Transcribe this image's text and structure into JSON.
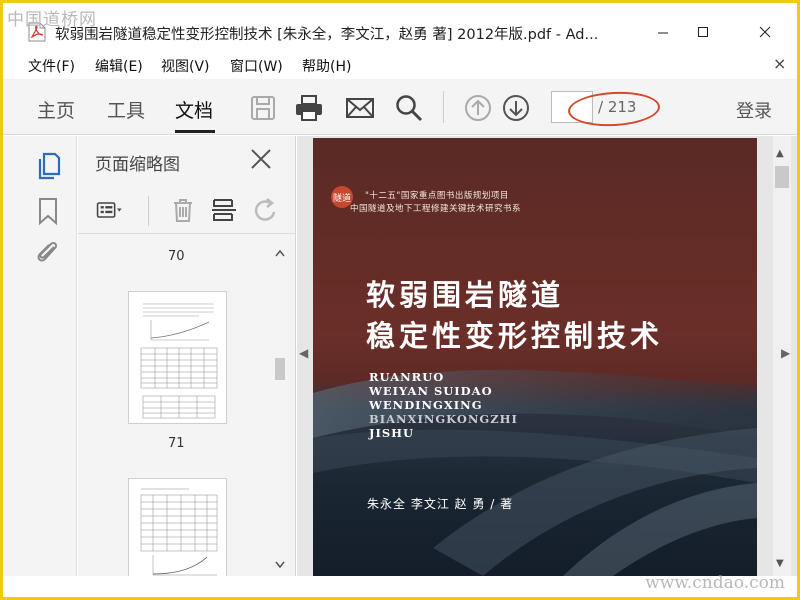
{
  "watermarks": {
    "top": "中国道桥网",
    "bottom": "www.cndao.com"
  },
  "window": {
    "title": "软弱围岩隧道稳定性变形控制技术 [朱永全，李文江，赵勇 著] 2012年版.pdf - Ad..."
  },
  "menu": {
    "items": [
      "文件(F)",
      "编辑(E)",
      "视图(V)",
      "窗口(W)",
      "帮助(H)"
    ],
    "close": "×"
  },
  "toolbar": {
    "tabs": [
      "主页",
      "工具",
      "文档"
    ],
    "active_tab": "文档",
    "page_total": "/ 213",
    "login": "登录",
    "icons": [
      "save-icon",
      "print-icon",
      "email-icon",
      "search-icon",
      "page-up-icon",
      "page-down-icon"
    ]
  },
  "rail": {
    "icons": [
      "page-thumbnails-icon",
      "bookmark-icon",
      "attachment-icon"
    ]
  },
  "thumbnails": {
    "title": "页面缩略图",
    "labels": [
      "70",
      "71"
    ],
    "icons": [
      "options-icon",
      "delete-icon",
      "extract-icon",
      "rotate-icon"
    ]
  },
  "cover": {
    "logo": "隧道",
    "series_line1": "\"十二五\"国家重点图书出版规划项目",
    "series_line2": "中国隧道及地下工程修建关键技术研究书系",
    "title_line1": "软弱围岩隧道",
    "title_line2": "稳定性变形控制技术",
    "pinyin": [
      "RUANRUO",
      "WEIYAN SUIDAO",
      "WENDINGXING",
      "BIANXINGKONGZHI",
      "JISHU"
    ],
    "authors": "朱永全  李文江  赵 勇  / 著"
  },
  "colors": {
    "frame": "#f2c811",
    "annotation_oval": "#d24a2a",
    "toolbar_bg": "#f4f4f4",
    "accent_blue": "#2a6ebb"
  }
}
